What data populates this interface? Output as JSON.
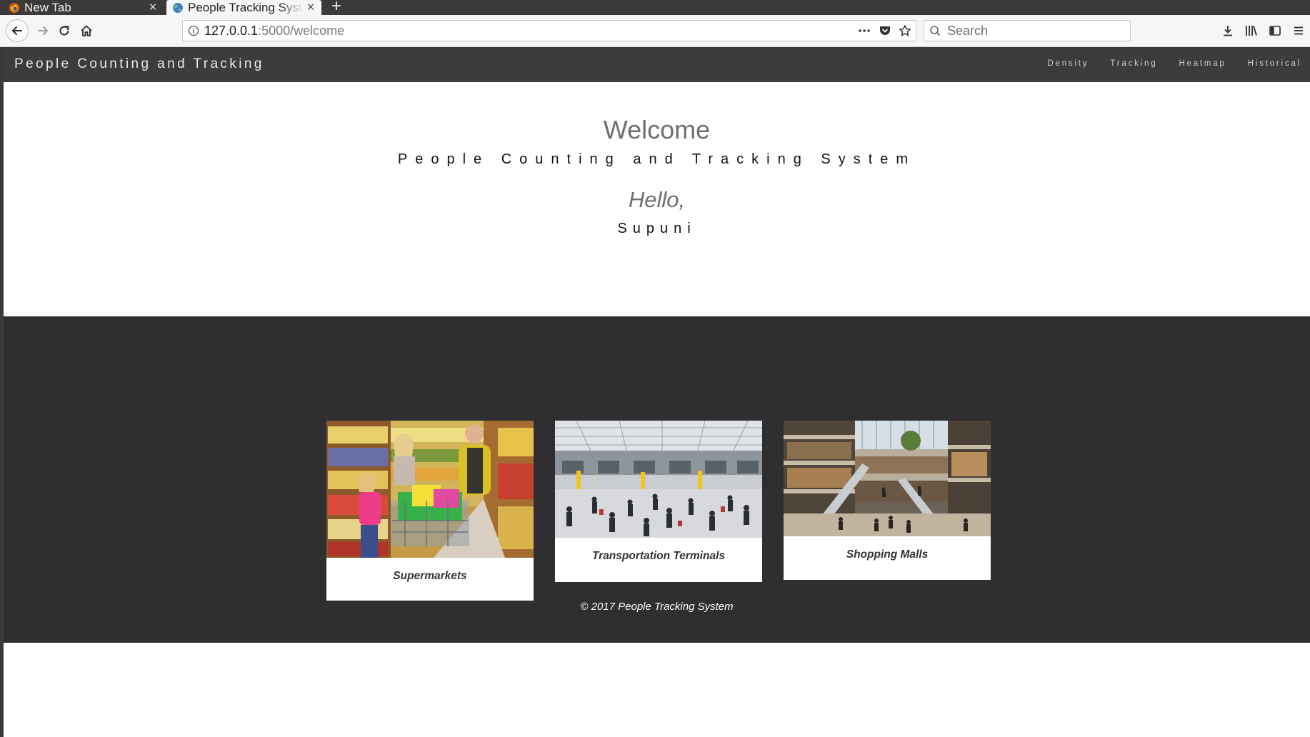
{
  "browser": {
    "tabs": [
      {
        "title": "New Tab",
        "active": false,
        "icon": "firefox-icon"
      },
      {
        "title": "People Tracking System",
        "active": true,
        "icon": "globe-icon"
      }
    ],
    "url_host": "127.0.0.1",
    "url_path": ":5000/welcome",
    "search_placeholder": "Search",
    "page_actions_icon": "more-horizontal-icon"
  },
  "site": {
    "brand": "People Counting and Tracking",
    "nav": [
      {
        "label": "Density"
      },
      {
        "label": "Tracking"
      },
      {
        "label": "Heatmap"
      },
      {
        "label": "Historical"
      }
    ]
  },
  "hero": {
    "heading": "Welcome",
    "subtitle": "People Counting and Tracking System",
    "greeting": "Hello,",
    "user": "Supuni"
  },
  "cards": [
    {
      "caption": "Supermarkets"
    },
    {
      "caption": "Transportation Terminals"
    },
    {
      "caption": "Shopping Malls"
    }
  ],
  "footer": {
    "copyright": "© 2017 People Tracking System"
  },
  "colors": {
    "site_nav_bg": "#3c3c3e",
    "dark_section_bg": "#2f2f31",
    "heading_gray": "#6f6f6f"
  }
}
